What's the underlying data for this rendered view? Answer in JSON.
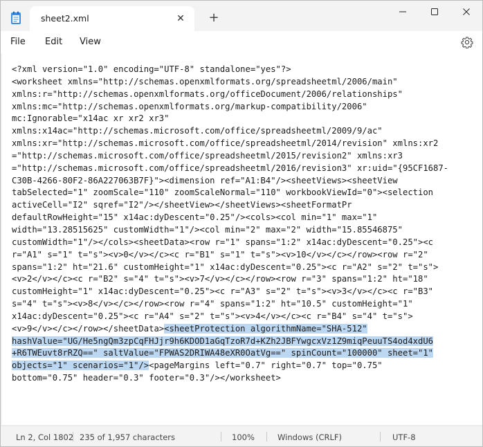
{
  "window": {
    "tab_title": "sheet2.xml",
    "close_tab_glyph": "✕",
    "new_tab_glyph": "+"
  },
  "menu": {
    "file": "File",
    "edit": "Edit",
    "view": "View"
  },
  "editor": {
    "lines": [
      "<?xml version=\"1.0\" encoding=\"UTF-8\" standalone=\"yes\"?>",
      "<worksheet xmlns=\"http://schemas.openxmlformats.org/spreadsheetml/2006/main\"",
      "xmlns:r=\"http://schemas.openxmlformats.org/officeDocument/2006/relationships\"",
      "xmlns:mc=\"http://schemas.openxmlformats.org/markup-compatibility/2006\"",
      "mc:Ignorable=\"x14ac xr xr2 xr3\"",
      "xmlns:x14ac=\"http://schemas.microsoft.com/office/spreadsheetml/2009/9/ac\"",
      "xmlns:xr=\"http://schemas.microsoft.com/office/spreadsheetml/2014/revision\" xmlns:xr2",
      "=\"http://schemas.microsoft.com/office/spreadsheetml/2015/revision2\" xmlns:xr3",
      "=\"http://schemas.microsoft.com/office/spreadsheetml/2016/revision3\" xr:uid=\"{95CF1687-",
      "C30B-4266-80F2-86A227063B7F}\"><dimension ref=\"A1:B4\"/><sheetViews><sheetView",
      "tabSelected=\"1\" zoomScale=\"110\" zoomScaleNormal=\"110\" workbookViewId=\"0\"><selection",
      "activeCell=\"I2\" sqref=\"I2\"/></sheetView></sheetViews><sheetFormatPr",
      "defaultRowHeight=\"15\" x14ac:dyDescent=\"0.25\"/><cols><col min=\"1\" max=\"1\"",
      "width=\"13.28515625\" customWidth=\"1\"/><col min=\"2\" max=\"2\" width=\"15.85546875\"",
      "customWidth=\"1\"/></cols><sheetData><row r=\"1\" spans=\"1:2\" x14ac:dyDescent=\"0.25\"><c",
      "r=\"A1\" s=\"1\" t=\"s\"><v>0</v></c><c r=\"B1\" s=\"1\" t=\"s\"><v>10</v></c></row><row r=\"2\"",
      "spans=\"1:2\" ht=\"21.6\" customHeight=\"1\" x14ac:dyDescent=\"0.25\"><c r=\"A2\" s=\"2\" t=\"s\">",
      "<v>2</v></c><c r=\"B2\" s=\"4\" t=\"s\"><v>7</v></c></row><row r=\"3\" spans=\"1:2\" ht=\"18\"",
      "customHeight=\"1\" x14ac:dyDescent=\"0.25\"><c r=\"A3\" s=\"2\" t=\"s\"><v>3</v></c><c r=\"B3\"",
      "s=\"4\" t=\"s\"><v>8</v></c></row><row r=\"4\" spans=\"1:2\" ht=\"10.5\" customHeight=\"1\"",
      "x14ac:dyDescent=\"0.25\"><c r=\"A4\" s=\"2\" t=\"s\"><v>4</v></c><c r=\"B4\" s=\"4\" t=\"s\">",
      "<v>9</v></c></row></sheetData>"
    ],
    "selected": [
      "<sheetProtection algorithmName=\"SHA-512\"",
      "hashValue=\"UG/He5ngQm3zpCqFHJjr9h6KDOD1aGqTzoR7d+KZh2JBFYwgcxVz1Z9miqPeuuTS4od4xdU6",
      "+R6TWEuvt8rRZQ==\" saltValue=\"FPWAS2DRIWA48eXR0OatVg==\" spinCount=\"100000\" sheet=\"1\"",
      "objects=\"1\" scenarios=\"1\"/>"
    ],
    "after_selection": [
      "<pageMargins left=\"0.7\" right=\"0.7\" top=\"0.75\"",
      "bottom=\"0.75\" header=\"0.3\" footer=\"0.3\"/></worksheet>"
    ]
  },
  "status": {
    "position": "Ln 2, Col 1802",
    "characters": "235 of 1,957 characters",
    "zoom": "100%",
    "line_ending": "Windows (CRLF)",
    "encoding": "UTF-8"
  }
}
